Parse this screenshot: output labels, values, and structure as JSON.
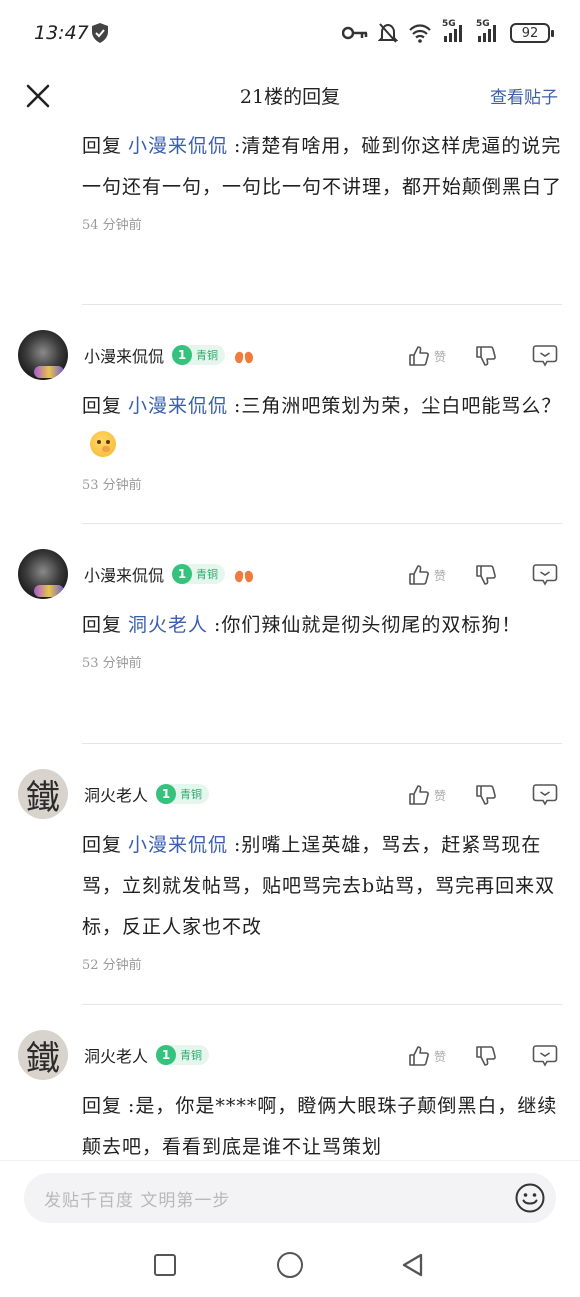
{
  "status_bar": {
    "time": "13:47",
    "battery": "92",
    "signal_1": "5G",
    "signal_2": "5G"
  },
  "header": {
    "title": "21楼的回复",
    "view_post": "查看贴子"
  },
  "reply_prefix": "回复",
  "first_reply": {
    "mention": "小漫来侃侃",
    "text": ":清楚有啥用，碰到你这样虎逼的说完一句还有一句，一句比一句不讲理，都开始颠倒黑白了",
    "time": "54 分钟前"
  },
  "like_label": "赞",
  "comments": [
    {
      "username": "小漫来侃侃",
      "level": "1",
      "badge": "青铜",
      "mention": "小漫来侃侃",
      "text": ":三角洲吧策划为荣，尘白吧能骂么？",
      "time": "53 分钟前"
    },
    {
      "username": "小漫来侃侃",
      "level": "1",
      "badge": "青铜",
      "mention": "洞火老人",
      "text": ":你们辣仙就是彻头彻尾的双标狗！",
      "time": "53 分钟前"
    },
    {
      "username": "洞火老人",
      "level": "1",
      "badge": "青铜",
      "avatar_char": "鐵",
      "mention": "小漫来侃侃",
      "text": ":别嘴上逞英雄，骂去，赶紧骂现在骂，立刻就发帖骂，贴吧骂完去b站骂，骂完再回来双标，反正人家也不改",
      "time": "52 分钟前"
    },
    {
      "username": "洞火老人",
      "level": "1",
      "badge": "青铜",
      "avatar_char": "鐵",
      "mention": "",
      "text": ":是，你是****啊，瞪俩大眼珠子颠倒黑白，继续颠去吧，看看到底是谁不让骂策划"
    }
  ],
  "input": {
    "placeholder": "发贴千百度 文明第一步"
  },
  "icons": [
    "shield-icon",
    "key-icon",
    "mute-bell-icon",
    "wifi-icon",
    "close-icon",
    "thumb-up-icon",
    "thumb-down-icon",
    "comment-icon",
    "smile-icon",
    "lungs-icon"
  ]
}
